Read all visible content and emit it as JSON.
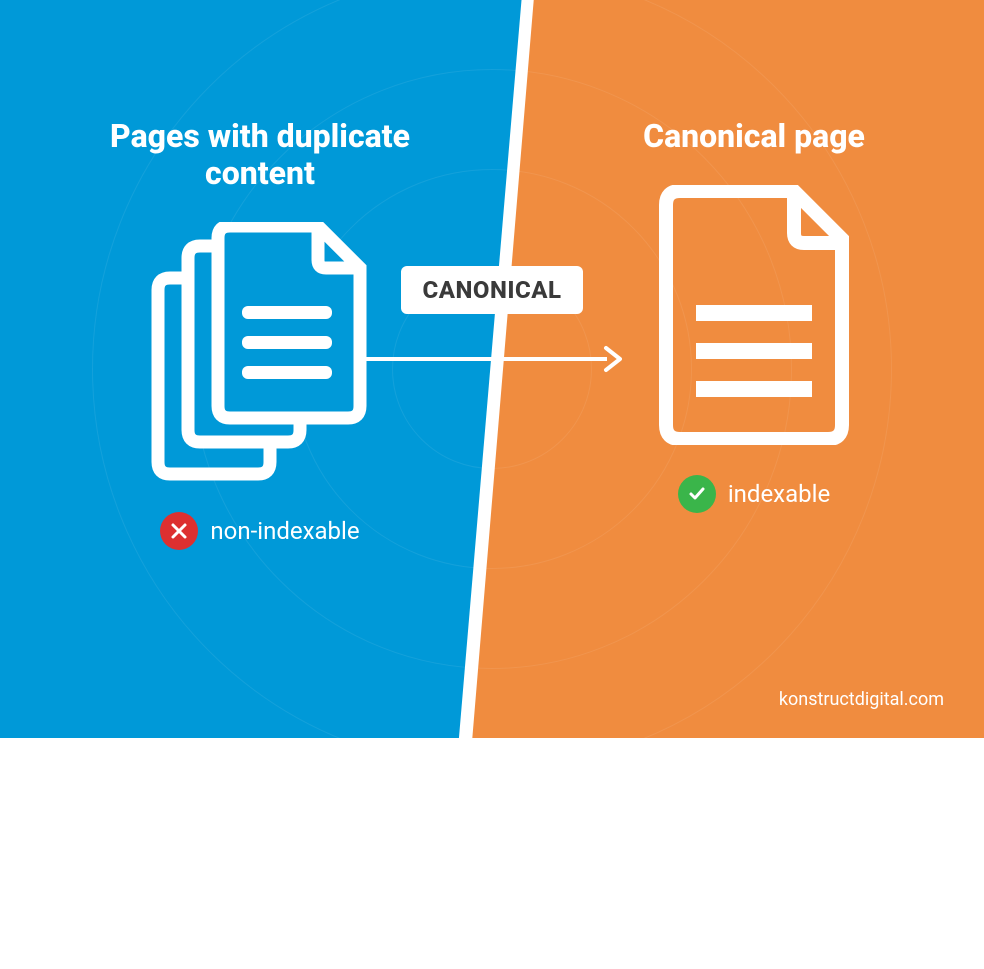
{
  "left": {
    "heading": "Pages with duplicate content",
    "status_label": "non-indexable"
  },
  "right": {
    "heading": "Canonical page",
    "status_label": "indexable"
  },
  "center": {
    "badge_label": "CANONICAL"
  },
  "footer": {
    "credit": "konstructdigital.com"
  },
  "colors": {
    "blue": "#0099d8",
    "orange": "#f08c3f",
    "red": "#dd3030",
    "green": "#3ab54a"
  }
}
